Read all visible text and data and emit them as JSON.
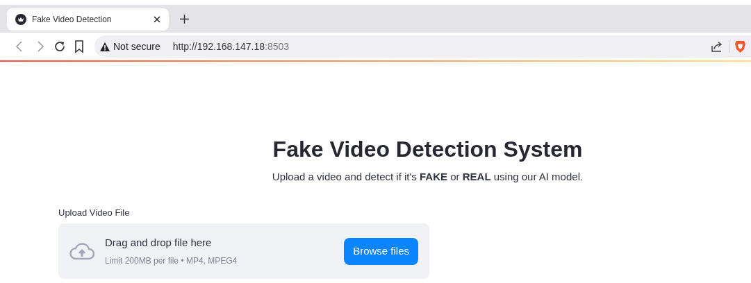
{
  "browser": {
    "tabs": [
      {
        "title": "Fake Video Detection",
        "selected": true
      }
    ],
    "security": "Not secure",
    "url_host": "http://192.168.147.18",
    "url_port": ":8503"
  },
  "page": {
    "title": "Fake Video Detection System",
    "subtitle": "Upload a video and detect if it's **FAKE** or **REAL** using our AI model.",
    "uploader": {
      "label": "Upload Video File",
      "instruction": "Drag and drop file here",
      "limits": "Limit 200MB per file • MP4, MPEG4",
      "button": "Browse files"
    }
  }
}
